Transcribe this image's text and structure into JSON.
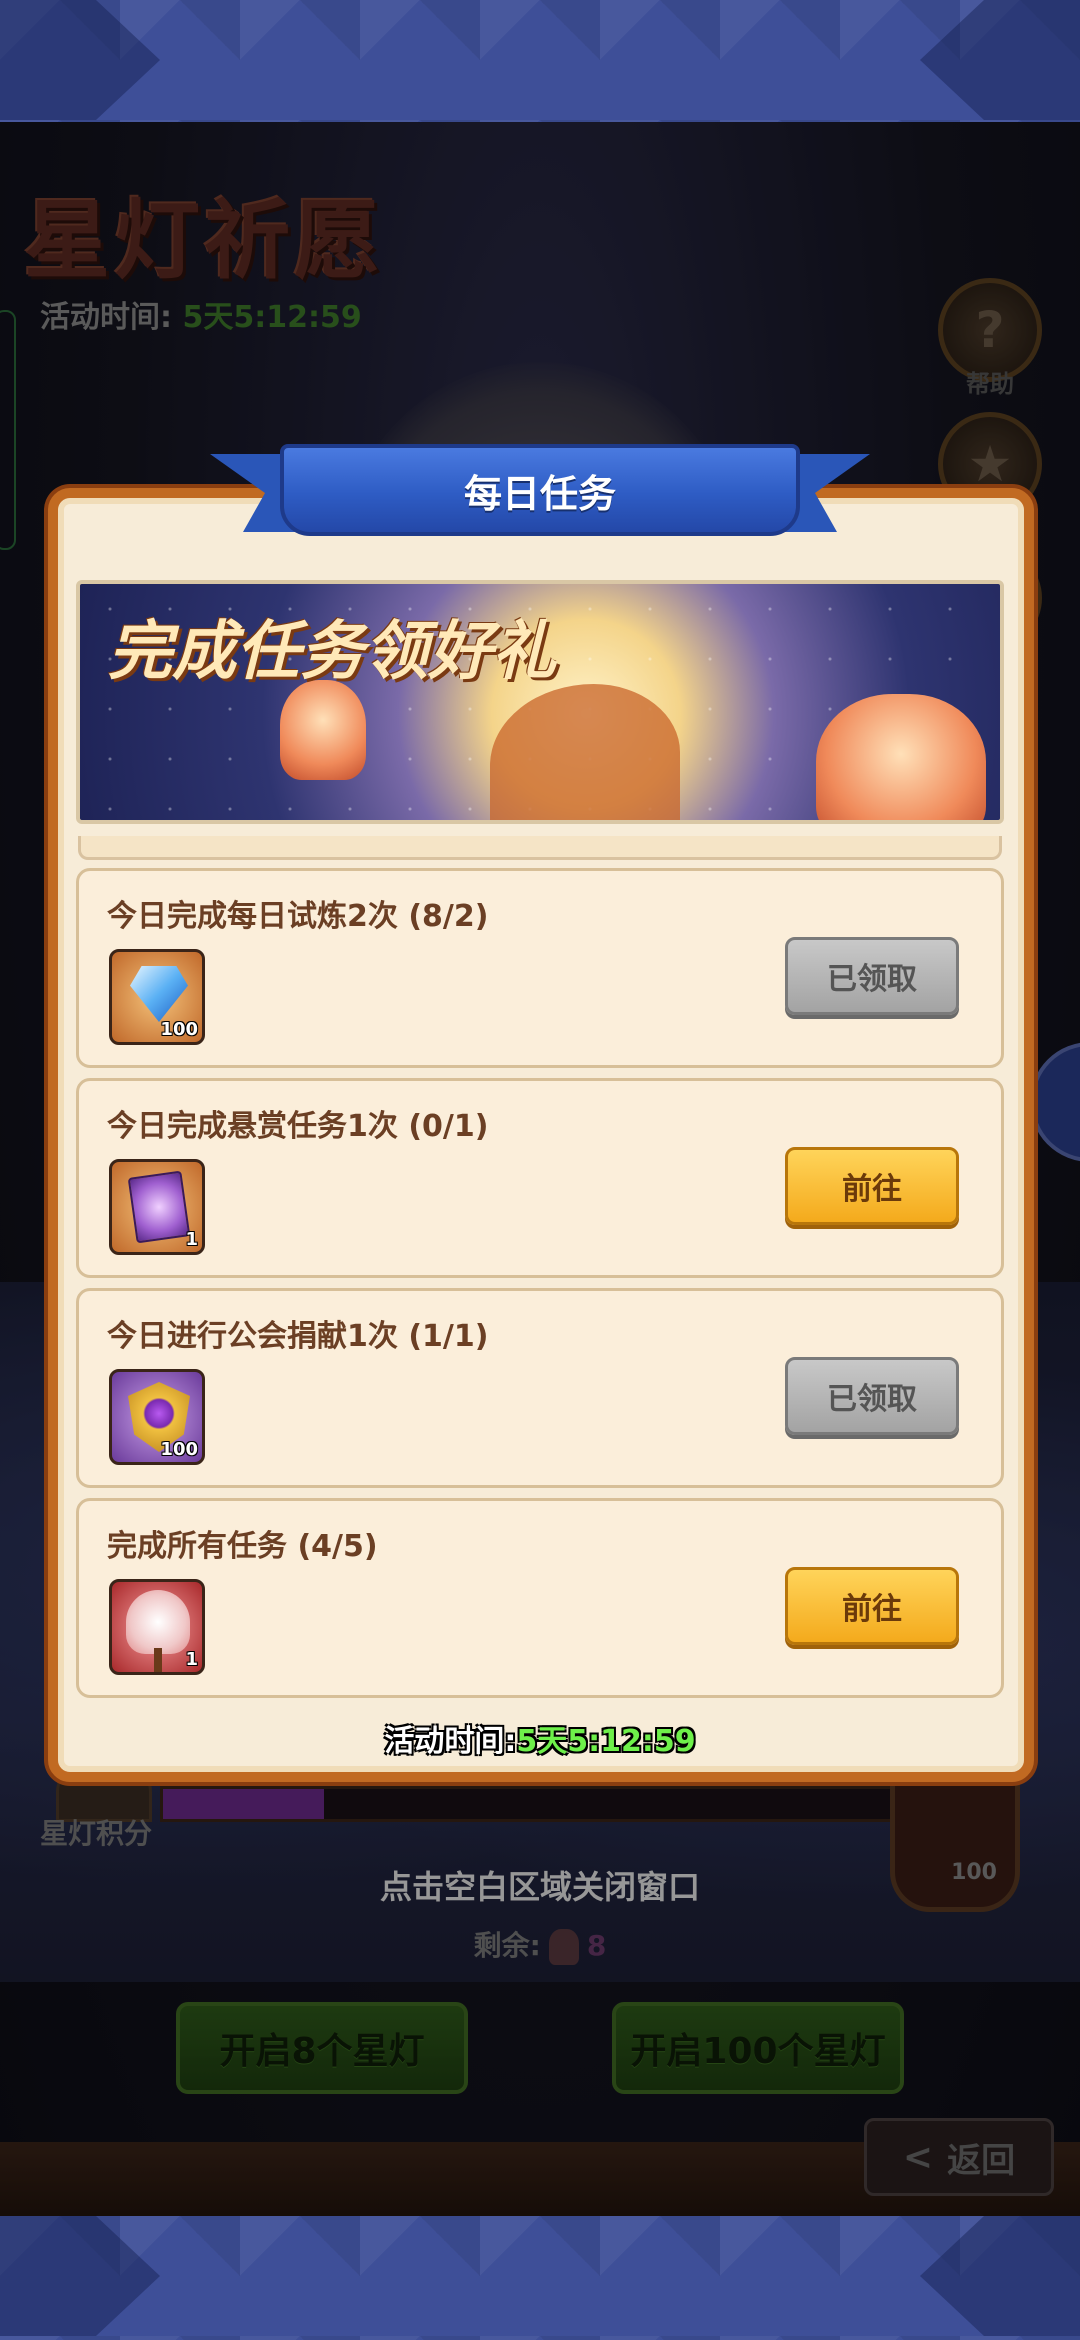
{
  "background": {
    "event_title": "星灯祈愿",
    "activity_time_label": "活动时间:",
    "activity_time_value": "5天5:12:59",
    "side_buttons": [
      {
        "label": "帮助",
        "icon": "question-icon"
      },
      {
        "label": "",
        "icon": "trophy-icon"
      }
    ],
    "score_label": "星灯积分",
    "score_progress": 0.22,
    "reward_count": "100",
    "close_hint": "点击空白区域关闭窗口",
    "remaining_label": "剩余:",
    "remaining_count": "8",
    "open_8_label": "开启8个星灯",
    "open_100_label": "开启100个星灯",
    "back_label": "返回"
  },
  "dialog": {
    "title": "每日任务",
    "banner_title": "完成任务领好礼",
    "tasks": [
      {
        "name": "今日完成每日试炼2次 (8/2)",
        "reward_icon": "diamond-icon",
        "reward_qty": "100",
        "button": "已领取",
        "state": "claimed"
      },
      {
        "name": "今日完成悬赏任务1次 (0/1)",
        "reward_icon": "purple-card-icon",
        "reward_qty": "1",
        "button": "前往",
        "state": "go"
      },
      {
        "name": "今日进行公会捐献1次 (1/1)",
        "reward_icon": "guild-medal-icon",
        "reward_qty": "100",
        "button": "已领取",
        "state": "claimed"
      },
      {
        "name": "完成所有任务 (4/5)",
        "reward_icon": "lantern-fan-icon",
        "reward_qty": "1",
        "button": "前往",
        "state": "go"
      }
    ],
    "time_label": "活动时间:",
    "time_value": "5天5:12:59"
  },
  "colors": {
    "dialog_border": "#c16a22",
    "ribbon": "#2e5cc4",
    "go_button": "#f4aa1c",
    "claimed_button": "#a3a3a3",
    "time_value": "#6ef04a"
  }
}
